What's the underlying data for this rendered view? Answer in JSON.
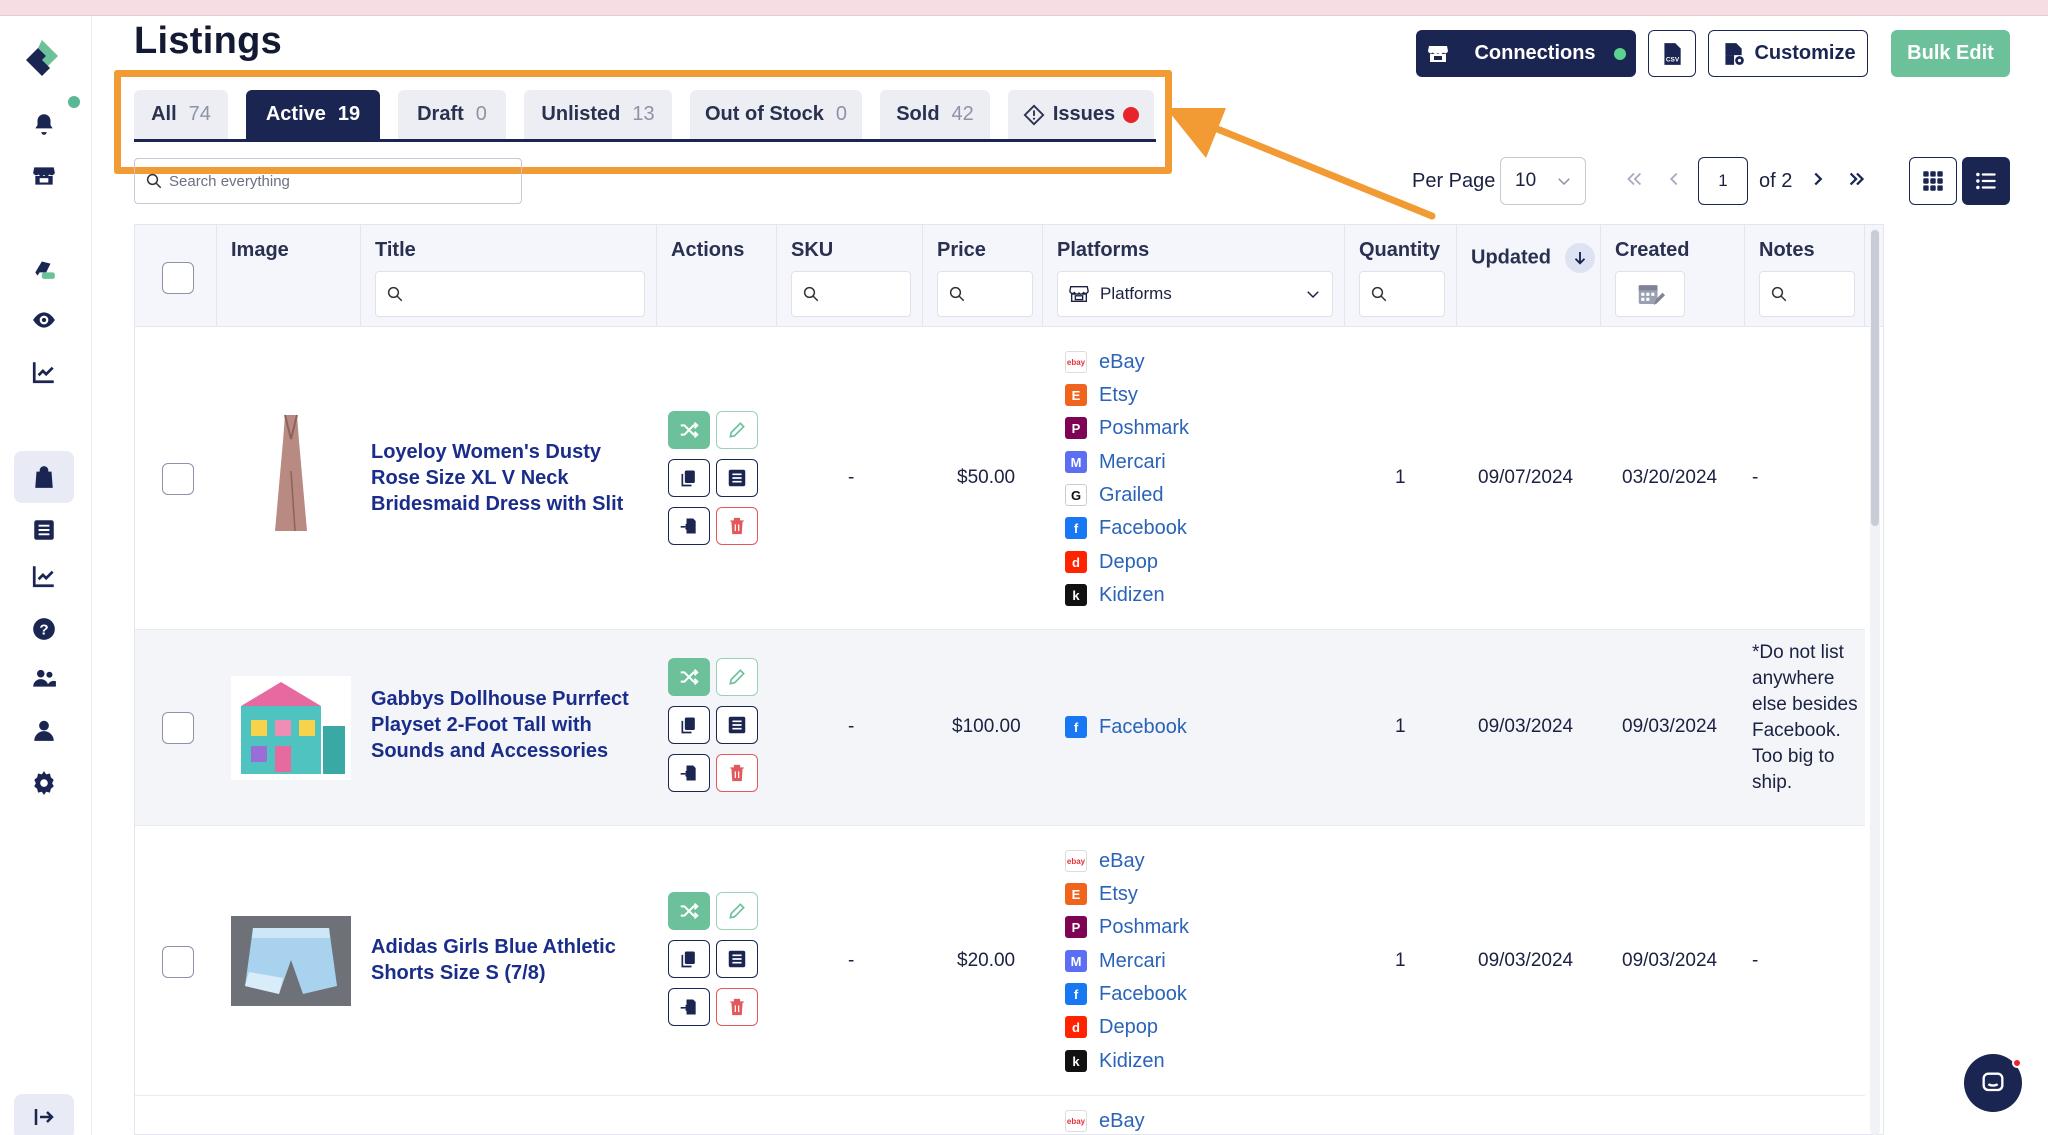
{
  "page": {
    "title": "Listings"
  },
  "header": {
    "connections_label": "Connections",
    "customize_label": "Customize",
    "bulk_edit_label": "Bulk Edit",
    "connection_status_color": "#5bd28f"
  },
  "tabs": [
    {
      "label": "All",
      "count": "74"
    },
    {
      "label": "Active",
      "count": "19",
      "active": true
    },
    {
      "label": "Draft",
      "count": "0"
    },
    {
      "label": "Unlisted",
      "count": "13"
    },
    {
      "label": "Out of Stock",
      "count": "0"
    },
    {
      "label": "Sold",
      "count": "42"
    },
    {
      "label": "Issues",
      "count": ""
    }
  ],
  "search": {
    "placeholder": "Search everything"
  },
  "pagination": {
    "per_page_label": "Per Page",
    "per_page_value": "10",
    "current_page": "1",
    "of_label": "of 2"
  },
  "columns": {
    "image": "Image",
    "title": "Title",
    "actions": "Actions",
    "sku": "SKU",
    "price": "Price",
    "platforms": "Platforms",
    "platforms_filter": "Platforms",
    "quantity": "Quantity",
    "updated": "Updated",
    "created": "Created",
    "notes": "Notes"
  },
  "rows": [
    {
      "title": "Loyeloy Women's Dusty Rose Size XL V Neck Bridesmaid Dress with Slit",
      "sku": "-",
      "price": "$50.00",
      "quantity": "1",
      "updated": "09/07/2024",
      "created": "03/20/2024",
      "notes": "-",
      "platforms": [
        "eBay",
        "Etsy",
        "Poshmark",
        "Mercari",
        "Grailed",
        "Facebook",
        "Depop",
        "Kidizen"
      ]
    },
    {
      "title": "Gabbys Dollhouse Purrfect Playset 2-Foot Tall with Sounds and Accessories",
      "sku": "-",
      "price": "$100.00",
      "quantity": "1",
      "updated": "09/03/2024",
      "created": "09/03/2024",
      "notes": "*Do not list anywhere else besides Facebook. Too big to ship.",
      "platforms": [
        "Facebook"
      ]
    },
    {
      "title": "Adidas Girls Blue Athletic Shorts Size S (7/8)",
      "sku": "-",
      "price": "$20.00",
      "quantity": "1",
      "updated": "09/03/2024",
      "created": "09/03/2024",
      "notes": "-",
      "platforms": [
        "eBay",
        "Etsy",
        "Poshmark",
        "Mercari",
        "Facebook",
        "Depop",
        "Kidizen"
      ]
    },
    {
      "platforms": [
        "eBay"
      ]
    }
  ],
  "platform_icons": {
    "eBay": {
      "icon": "ebay-logo-icon",
      "color": "#ffffff"
    },
    "Etsy": {
      "icon": "etsy-logo-icon",
      "color": "#f1641e"
    },
    "Poshmark": {
      "icon": "poshmark-logo-icon",
      "color": "#7f0353"
    },
    "Mercari": {
      "icon": "mercari-logo-icon",
      "color": "#5c6ff2"
    },
    "Grailed": {
      "icon": "grailed-logo-icon",
      "color": "#ffffff"
    },
    "Facebook": {
      "icon": "facebook-logo-icon",
      "color": "#1877f2"
    },
    "Depop": {
      "icon": "depop-logo-icon",
      "color": "#ff2300"
    },
    "Kidizen": {
      "icon": "kidizen-logo-icon",
      "color": "#111111"
    }
  },
  "colors": {
    "navy": "#1b2552",
    "accent_green": "#6cc19a",
    "highlight_orange": "#f29b35",
    "issue_red": "#e8242b"
  }
}
